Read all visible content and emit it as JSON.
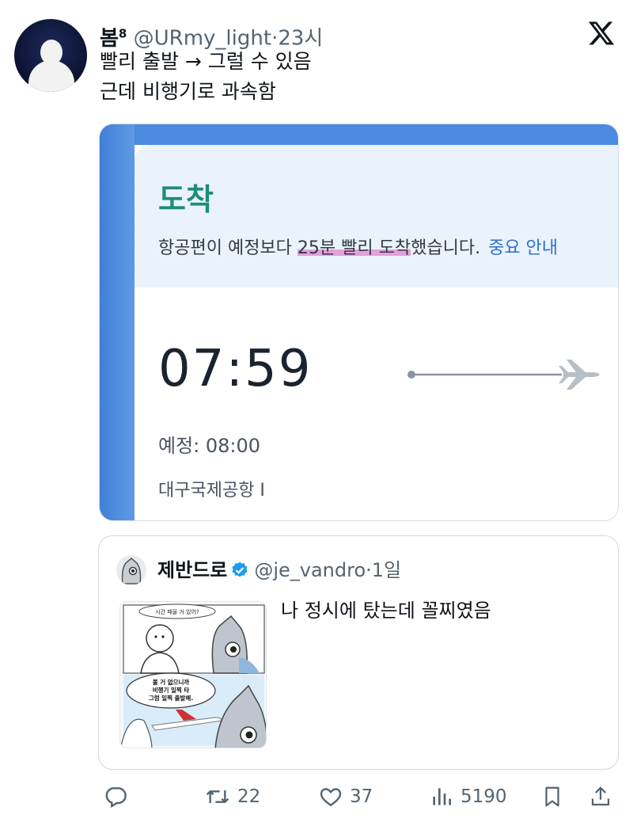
{
  "author": {
    "display_name": "봄",
    "name_suffix": "8",
    "handle": "@URmy_light",
    "separator": "·",
    "time": "23시"
  },
  "tweet": {
    "lines": [
      "빨리 출발 → 그럴 수 있음",
      "근데 비행기로 과속함"
    ]
  },
  "media": {
    "title": "도착",
    "message_before": "항공편이 예정보다 ",
    "message_highlight": "25분 빨리 도착",
    "message_after": "했습니다.",
    "link": "중요 안내",
    "arrival_time": "07:59",
    "scheduled": "예정: 08:00",
    "airport": "대구국제공항 I"
  },
  "quote": {
    "display_name": "제반드로",
    "handle": "@je_vandro",
    "separator": "·",
    "time": "1일",
    "text": "나 정시에 탔는데 꼴찌였음",
    "thumb": {
      "bubble_top": "시간 때울 거 있어?",
      "bubble_mid_1": "볼 거 없으니까",
      "bubble_mid_2": "비행기 일찍 타",
      "bubble_mid_3": "그럼 일찍 출발해."
    }
  },
  "actions": {
    "reply_count": "",
    "retweet_count": "22",
    "like_count": "37",
    "view_count": "5190"
  },
  "colors": {
    "accent": "#1d9bf0",
    "media_blue": "#4a8be0",
    "title_green": "#1f8c7a",
    "highlight_pink": "#dc5abe",
    "text_gray": "#536471"
  },
  "icons": [
    "reply-icon",
    "retweet-icon",
    "like-icon",
    "views-icon",
    "bookmark-icon",
    "share-icon",
    "x-logo-icon",
    "verified-icon",
    "airplane-icon"
  ]
}
